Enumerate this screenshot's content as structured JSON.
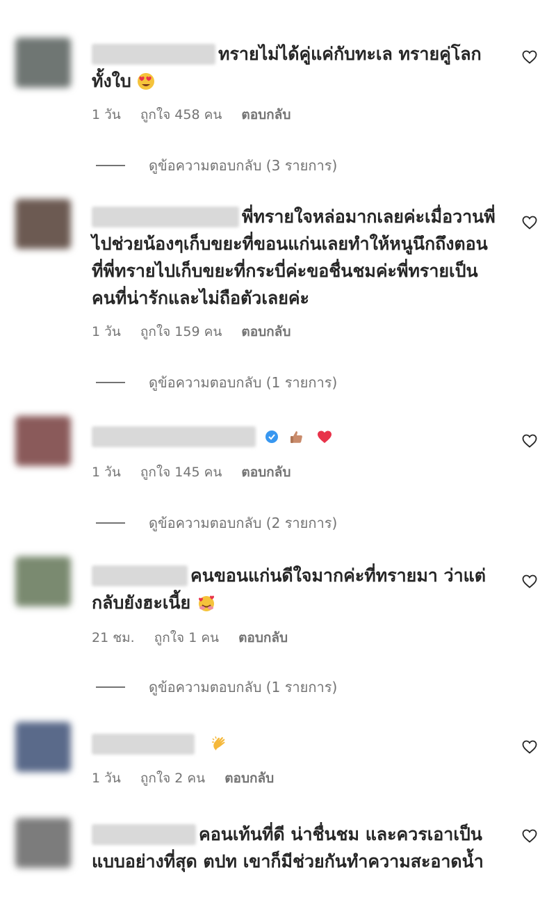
{
  "comments": [
    {
      "text": "ทรายไม่ได้คู่แค่กับทะเล ทรายคู่โลกทั้งใบ",
      "emoji": "heart-eyes",
      "time": "1 วัน",
      "likes": "ถูกใจ 458 คน",
      "reply": "ตอบกลับ",
      "view_replies": "ดูข้อความตอบกลับ (3 รายการ)",
      "avatar_color": "#6f7673"
    },
    {
      "text": "พี่ทรายใจหล่อมากเลยค่ะเมื่อวานพี่ไปช่วยน้องๆเก็บขยะที่ขอนแก่นเลยทำให้หนูนึกถึงตอนที่พี่ทรายไปเก็บขยะที่กระบี่ค่ะขอชื่นชมค่ะพี่ทรายเป็นคนที่น่ารักและไม่ถือตัวเลยค่ะ",
      "time": "1 วัน",
      "likes": "ถูกใจ 159 คน",
      "reply": "ตอบกลับ",
      "view_replies": "ดูข้อความตอบกลับ (1 รายการ)",
      "avatar_color": "#6c5a52"
    },
    {
      "text": "",
      "emoji": "thumbs-up heart",
      "time": "1 วัน",
      "likes": "ถูกใจ 145 คน",
      "reply": "ตอบกลับ",
      "view_replies": "ดูข้อความตอบกลับ (2 รายการ)",
      "avatar_color": "#8a5a5a"
    },
    {
      "text": "คนขอนแก่นดีใจมากค่ะที่ทรายมา ว่าแต่กลับยังฮะเนี้ย",
      "emoji": "hugging-hearts",
      "time": "21 ชม.",
      "likes": "ถูกใจ 1 คน",
      "reply": "ตอบกลับ",
      "view_replies": "ดูข้อความตอบกลับ (1 รายการ)",
      "avatar_color": "#7a8a70"
    },
    {
      "text": "",
      "emoji": "clapping",
      "time": "1 วัน",
      "likes": "ถูกใจ 2 คน",
      "reply": "ตอบกลับ",
      "avatar_color": "#5a6a8a"
    },
    {
      "text": "คอนเท้นที่ดี น่าชื่นชม และควรเอาเป็นแบบอย่างที่สุด ตปท เขาก็มีช่วยกันทำความสะอาดน้ำ",
      "avatar_color": "#7c7c7c"
    }
  ],
  "colors": {
    "text": "#262626",
    "meta": "#737373",
    "blur": "#d9d9d9"
  },
  "icons": {
    "like": "heart-outline-icon",
    "verified": "verified-badge-icon"
  }
}
